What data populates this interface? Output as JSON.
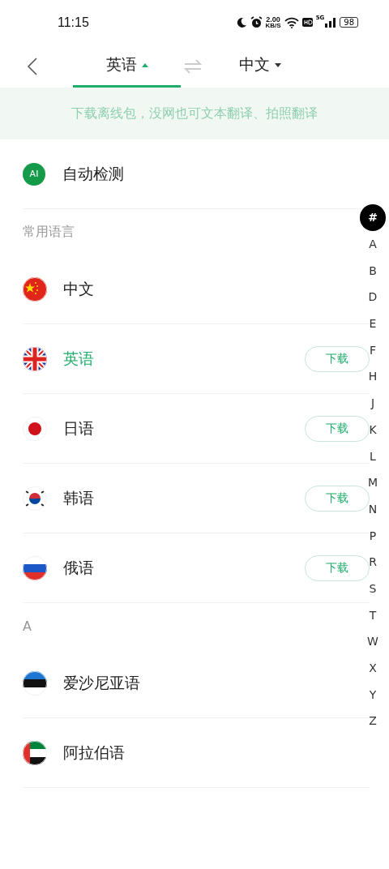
{
  "status_bar": {
    "time": "11:15",
    "speed_value": "2.00",
    "speed_unit": "KB/S",
    "network": "5G",
    "battery": "98"
  },
  "header": {
    "tabs": [
      {
        "label": "英语",
        "selected": true
      },
      {
        "label": "中文",
        "selected": false
      }
    ]
  },
  "banner": "下载离线包，没网也可文本翻译、拍照翻译",
  "sections": [
    {
      "items": [
        {
          "kind": "auto",
          "badge": "AI",
          "name": "自动检测",
          "selected": false
        }
      ]
    },
    {
      "header": "常用语言",
      "items": [
        {
          "kind": "language",
          "name": "中文",
          "selected": false
        },
        {
          "kind": "language",
          "name": "英语",
          "selected": true,
          "action": "下载"
        },
        {
          "kind": "language",
          "name": "日语",
          "selected": false,
          "action": "下载"
        },
        {
          "kind": "language",
          "name": "韩语",
          "selected": false,
          "action": "下载"
        },
        {
          "kind": "language",
          "name": "俄语",
          "selected": false,
          "action": "下载"
        }
      ]
    },
    {
      "header": "A",
      "items": [
        {
          "kind": "language",
          "name": "爱沙尼亚语",
          "selected": false
        },
        {
          "kind": "language",
          "name": "阿拉伯语",
          "selected": false
        }
      ]
    }
  ],
  "index": [
    {
      "label": "#",
      "selected": true
    },
    {
      "label": "A",
      "selected": false
    },
    {
      "label": "B",
      "selected": false
    },
    {
      "label": "D",
      "selected": false
    },
    {
      "label": "E",
      "selected": false
    },
    {
      "label": "F",
      "selected": false
    },
    {
      "label": "H",
      "selected": false
    },
    {
      "label": "J",
      "selected": false
    },
    {
      "label": "K",
      "selected": false
    },
    {
      "label": "L",
      "selected": false
    },
    {
      "label": "M",
      "selected": false
    },
    {
      "label": "N",
      "selected": false
    },
    {
      "label": "P",
      "selected": false
    },
    {
      "label": "R",
      "selected": false
    },
    {
      "label": "S",
      "selected": false
    },
    {
      "label": "T",
      "selected": false
    },
    {
      "label": "W",
      "selected": false
    },
    {
      "label": "X",
      "selected": false
    },
    {
      "label": "Y",
      "selected": false
    },
    {
      "label": "Z",
      "selected": false
    }
  ]
}
